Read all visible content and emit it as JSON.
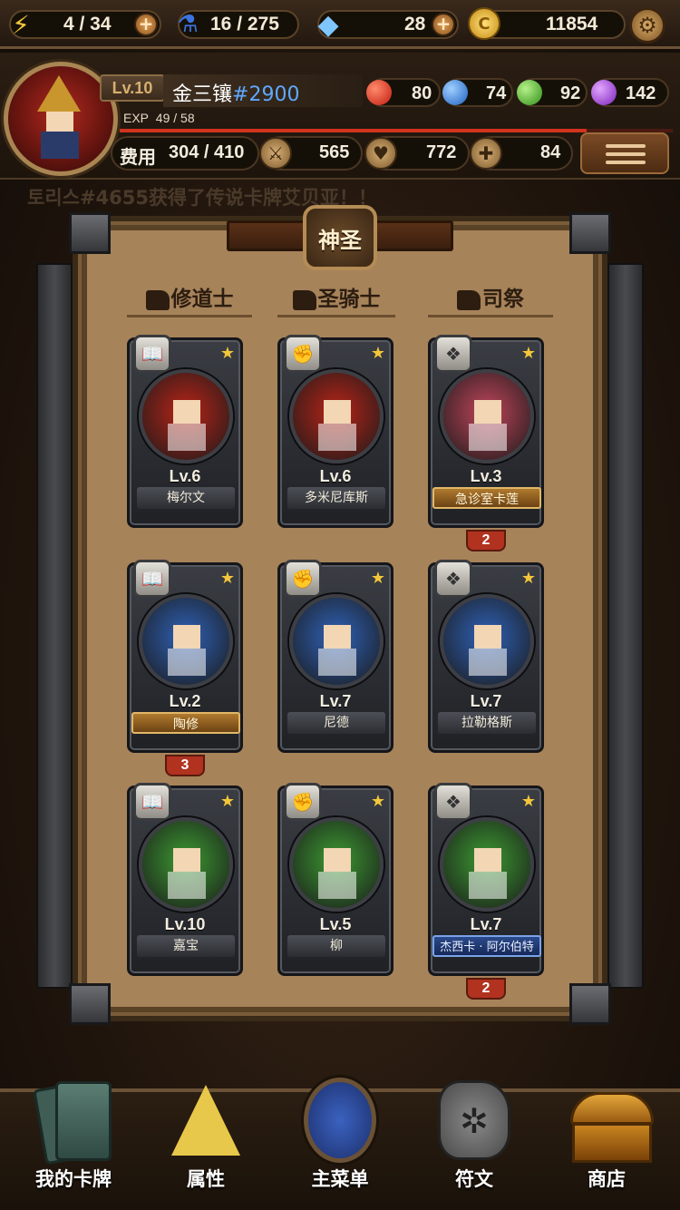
{
  "topbar": {
    "energy": "4 / 34",
    "potion": "16 / 275",
    "gems": "28",
    "gold": "11854",
    "icons": [
      "lightning-icon",
      "potion-icon",
      "diamond-icon",
      "coin-icon",
      "settings-gear-icon"
    ]
  },
  "profile": {
    "level": "Lv.10",
    "name": "金三镶",
    "tag": "#2900",
    "exp_label": "EXP",
    "exp_value": "49 / 58",
    "exp_fraction": 0.845,
    "orbs": [
      {
        "name": "red",
        "value": "80",
        "color": "#d8321e"
      },
      {
        "name": "blue",
        "value": "74",
        "color": "#3a8ee0"
      },
      {
        "name": "green",
        "value": "92",
        "color": "#4cbd2e"
      },
      {
        "name": "purple",
        "value": "142",
        "color": "#a347d6"
      }
    ],
    "cost_label": "费用",
    "cost_value": "304 / 410",
    "attack": "565",
    "hp": "772",
    "heal": "84"
  },
  "ticker": "토리스#4655获得了传说卡牌艾贝亚！！",
  "panel": {
    "title": "神圣",
    "columns": [
      "修道士",
      "圣骑士",
      "司祭"
    ]
  },
  "cards": [
    {
      "level": "Lv.6",
      "name": "梅尔文",
      "cls": "📖",
      "bg": "#b82418",
      "style": ""
    },
    {
      "level": "Lv.6",
      "name": "多米尼库斯",
      "cls": "✊",
      "bg": "#b82418",
      "style": ""
    },
    {
      "level": "Lv.3",
      "name": "急诊室卡莲",
      "cls": "❖",
      "bg": "#c0455a",
      "style": "gold",
      "count": "2"
    },
    {
      "level": "Lv.2",
      "name": "陶修",
      "cls": "📖",
      "bg": "#2f62b8",
      "style": "gold",
      "count": "3"
    },
    {
      "level": "Lv.7",
      "name": "尼德",
      "cls": "✊",
      "bg": "#2f62b8",
      "style": ""
    },
    {
      "level": "Lv.7",
      "name": "拉勒格斯",
      "cls": "❖",
      "bg": "#2f62b8",
      "style": ""
    },
    {
      "level": "Lv.10",
      "name": "嘉宝",
      "cls": "📖",
      "bg": "#3c9a32",
      "style": ""
    },
    {
      "level": "Lv.5",
      "name": "柳",
      "cls": "✊",
      "bg": "#3c9a32",
      "style": ""
    },
    {
      "level": "Lv.7",
      "name": "杰西卡 · 阿尔伯特",
      "cls": "❖",
      "bg": "#3c9a32",
      "style": "blue",
      "count": "2"
    }
  ],
  "nav": [
    {
      "label": "我的卡牌",
      "icon": "cards-icon"
    },
    {
      "label": "属性",
      "icon": "triangle-crystal-icon"
    },
    {
      "label": "主菜单",
      "icon": "emblem-icon"
    },
    {
      "label": "符文",
      "icon": "rune-stone-icon"
    },
    {
      "label": "商店",
      "icon": "treasure-chest-icon"
    }
  ]
}
